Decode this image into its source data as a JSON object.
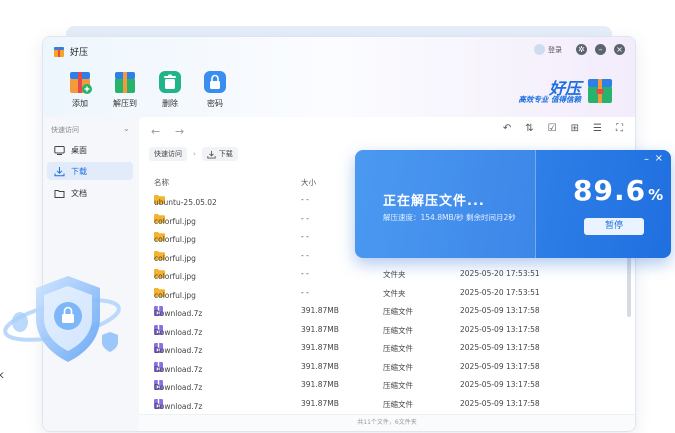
{
  "app": {
    "title": "好压",
    "login_label": "登录",
    "brand_name": "好压",
    "brand_slogan": "高效专业 值得信赖",
    "accent_color": "#1d6fe0"
  },
  "window_controls": [
    "settings-icon",
    "minimize-icon",
    "close-icon"
  ],
  "toolbar": {
    "add_label": "添加",
    "extract_label": "解压到",
    "delete_label": "删除",
    "password_label": "密码"
  },
  "sidebar": {
    "heading": "快速访问",
    "items": [
      {
        "label": "桌面",
        "icon": "desktop-icon"
      },
      {
        "label": "下载",
        "icon": "download-icon"
      },
      {
        "label": "文档",
        "icon": "folder-icon"
      }
    ]
  },
  "breadcrumb": {
    "root": "快速访问",
    "current": "下载"
  },
  "table": {
    "headers": {
      "name": "名称",
      "size": "大小"
    },
    "rows": [
      {
        "name": "ubuntu-25.05.02",
        "size": "- -",
        "type": "",
        "date": "",
        "kind": "folder"
      },
      {
        "name": "colorful.jpg",
        "size": "- -",
        "type": "",
        "date": "",
        "kind": "folder"
      },
      {
        "name": "colorful.jpg",
        "size": "- -",
        "type": "",
        "date": "",
        "kind": "folder"
      },
      {
        "name": "colorful.jpg",
        "size": "- -",
        "type": "",
        "date": "",
        "kind": "folder"
      },
      {
        "name": "colorful.jpg",
        "size": "- -",
        "type": "文件夹",
        "date": "2025-05-20 17:53:51",
        "kind": "folder"
      },
      {
        "name": "colorful.jpg",
        "size": "- -",
        "type": "文件夹",
        "date": "2025-05-20 17:53:51",
        "kind": "folder"
      },
      {
        "name": "Download.7z",
        "size": "391.87MB",
        "type": "压缩文件",
        "date": "2025-05-09 13:17:58",
        "kind": "archive"
      },
      {
        "name": "Download.7z",
        "size": "391.87MB",
        "type": "压缩文件",
        "date": "2025-05-09 13:17:58",
        "kind": "archive"
      },
      {
        "name": "Download.7z",
        "size": "391.87MB",
        "type": "压缩文件",
        "date": "2025-05-09 13:17:58",
        "kind": "archive"
      },
      {
        "name": "Download.7z",
        "size": "391.87MB",
        "type": "压缩文件",
        "date": "2025-05-09 13:17:58",
        "kind": "archive"
      },
      {
        "name": "Download.7z",
        "size": "391.87MB",
        "type": "压缩文件",
        "date": "2025-05-09 13:17:58",
        "kind": "archive"
      },
      {
        "name": "Download.7z",
        "size": "391.87MB",
        "type": "压缩文件",
        "date": "2025-05-09 13:17:58",
        "kind": "archive"
      }
    ]
  },
  "status_bar": "共11个文件，6文件夹",
  "progress_popup": {
    "title": "正在解压文件...",
    "speed_text": "解压速度：154.8MB/秒  剩余时间月2秒",
    "percent_value": "89.6",
    "percent_sign": "%",
    "pause_label": "暂停"
  },
  "background_glyph": "k"
}
